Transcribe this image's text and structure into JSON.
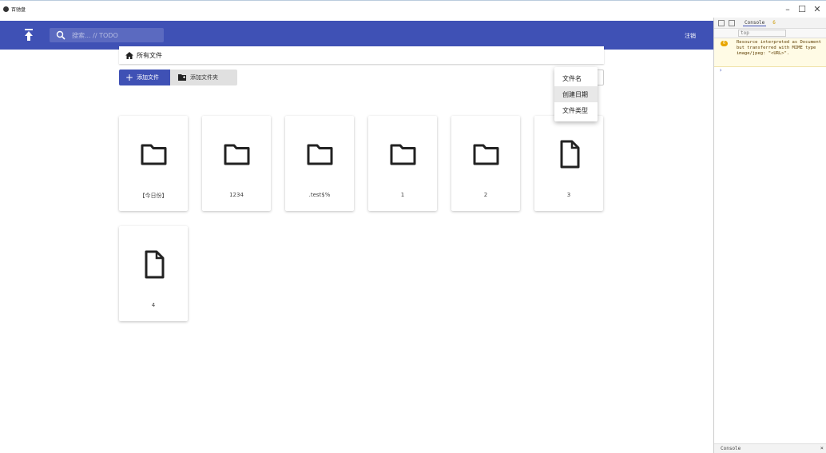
{
  "window": {
    "title": "百驰盘",
    "minimize": "–",
    "maximize": "☐",
    "close": "✕"
  },
  "colors": {
    "primary": "#3f51b5"
  },
  "header": {
    "search_placeholder": "搜索... // TODO",
    "logout_label": "注销"
  },
  "breadcrumb": {
    "label": "所有文件"
  },
  "toolbar": {
    "add_file_label": "添加文件",
    "add_folder_label": "添加文件夹"
  },
  "sort_menu": {
    "items": [
      {
        "label": "文件名"
      },
      {
        "label": "创建日期"
      },
      {
        "label": "文件类型"
      }
    ]
  },
  "files": [
    {
      "name": "【今日份】",
      "type": "folder"
    },
    {
      "name": "1234",
      "type": "folder"
    },
    {
      "name": ".test$%",
      "type": "folder"
    },
    {
      "name": "1",
      "type": "folder"
    },
    {
      "name": "2",
      "type": "folder"
    },
    {
      "name": "3",
      "type": "file"
    },
    {
      "name": "4",
      "type": "file"
    }
  ],
  "devtools": {
    "tab_label": "Console",
    "warn_count": "6",
    "context": "top",
    "badge": "6",
    "message": "Resource interpreted as Document but transferred with MIME type image/jpeg: \"<URL>\".",
    "prompt": "›",
    "drawer_label": "Console",
    "drawer_close": "×"
  }
}
